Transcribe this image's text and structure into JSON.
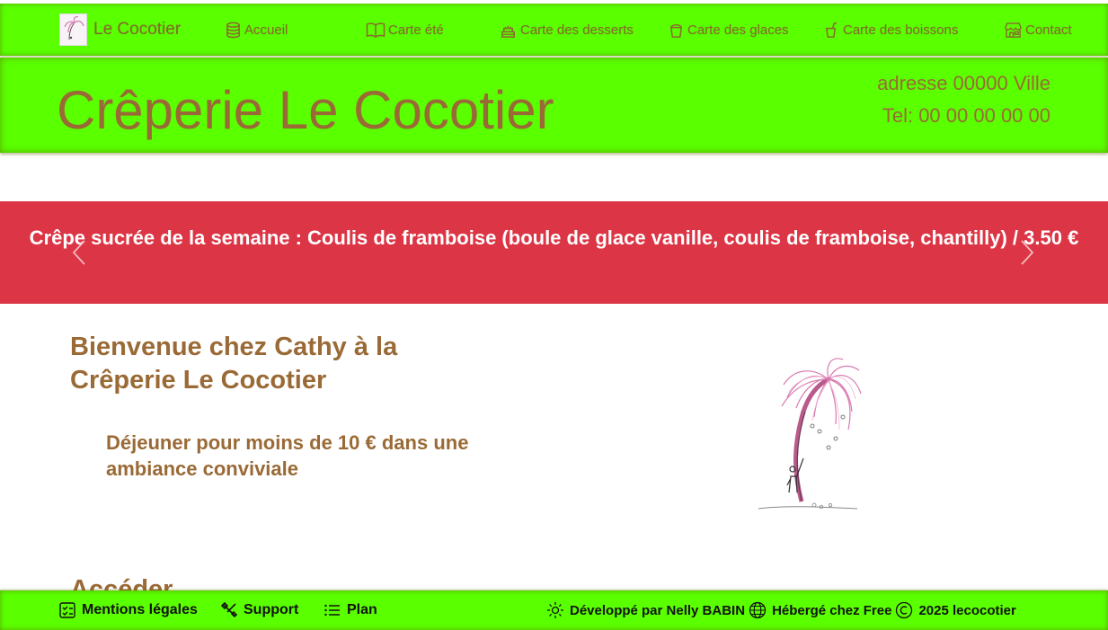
{
  "nav": {
    "brand": "Le Cocotier",
    "items": [
      {
        "label": "Accueil",
        "icon": "database-icon"
      },
      {
        "label": "Carte été",
        "icon": "book-icon"
      },
      {
        "label": "Carte des desserts",
        "icon": "cake-icon"
      },
      {
        "label": "Carte des glaces",
        "icon": "bucket-icon"
      },
      {
        "label": "Carte des boissons",
        "icon": "cup-straw-icon"
      },
      {
        "label": "Contact",
        "icon": "shop-icon"
      }
    ]
  },
  "header": {
    "title": "Crêperie Le Cocotier",
    "address": "adresse 00000 Ville",
    "phone": "Tel: 00 00 00 00 00"
  },
  "banner": {
    "text": "Crêpe sucrée de la semaine : Coulis de framboise (boule de glace vanille, coulis de framboise, chantilly) / 3.50 €"
  },
  "main": {
    "welcome_title": "Bienvenue chez Cathy à la Crêperie Le Cocotier",
    "welcome_subtitle": "Déjeuner pour moins de 10 € dans une ambiance conviviale",
    "next_heading": "Accéder"
  },
  "footer": {
    "legal": "Mentions légales",
    "support": "Support",
    "plan": "Plan",
    "developed": "Développé par Nelly BABIN",
    "hosted": "Hébergé chez Free",
    "copyright": "2025 lecocotier"
  },
  "colors": {
    "accent_green": "#5aff00",
    "brown_text": "#9a6a36",
    "banner_red": "#dc3545"
  }
}
